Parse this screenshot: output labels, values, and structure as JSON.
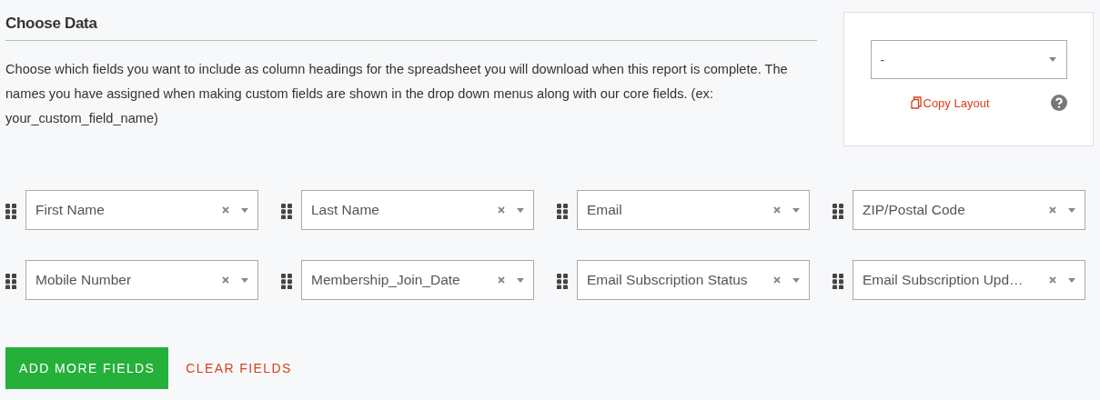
{
  "section": {
    "title": "Choose Data",
    "description": "Choose which fields you want to include as column headings for the spreadsheet you will download when this report is complete. The names you have assigned when making custom fields are shown in the drop down menus along with our core fields. (ex: your_custom_field_name)"
  },
  "layout_panel": {
    "select_value": "-",
    "copy_link": "Copy Layout"
  },
  "fields": [
    {
      "value": "First Name"
    },
    {
      "value": "Last Name"
    },
    {
      "value": "Email"
    },
    {
      "value": "ZIP/Postal Code"
    },
    {
      "value": "Mobile Number"
    },
    {
      "value": "Membership_Join_Date"
    },
    {
      "value": "Email Subscription Status"
    },
    {
      "value": "Email Subscription Upd…"
    }
  ],
  "buttons": {
    "add": "ADD MORE FIELDS",
    "clear": "CLEAR FIELDS"
  }
}
